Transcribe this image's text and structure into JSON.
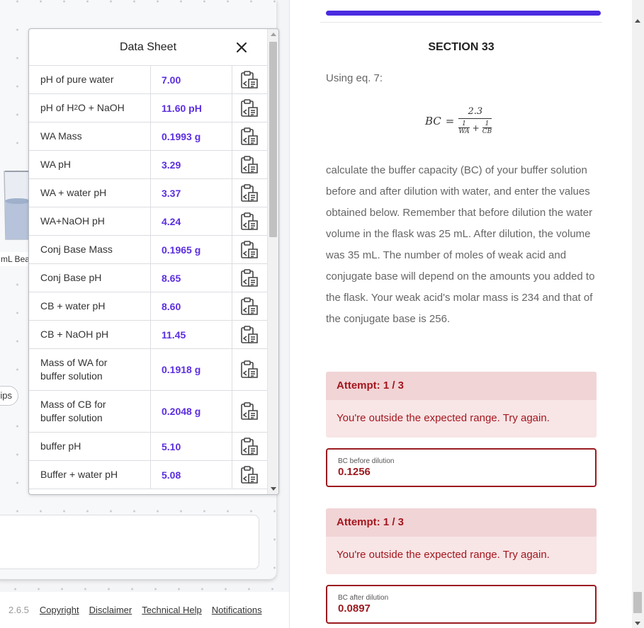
{
  "lab": {
    "beaker_label": "mL Bea",
    "tips_label": "ips",
    "version": "2.6.5",
    "footer_links": [
      "Copyright",
      "Disclaimer",
      "Technical Help",
      "Notifications"
    ]
  },
  "data_sheet": {
    "title": "Data Sheet",
    "rows": [
      {
        "label": "pH of pure water",
        "value": "7.00"
      },
      {
        "label_parts": [
          "pH of H",
          "2",
          "O + NaOH"
        ],
        "value": "11.60 pH"
      },
      {
        "label": "WA Mass",
        "value": "0.1993 g"
      },
      {
        "label": "WA pH",
        "value": "3.29"
      },
      {
        "label": "WA + water pH",
        "value": "3.37"
      },
      {
        "label": "WA+NaOH pH",
        "value": "4.24"
      },
      {
        "label": "Conj Base Mass",
        "value": "0.1965 g"
      },
      {
        "label": "Conj Base pH",
        "value": "8.65"
      },
      {
        "label": "CB + water pH",
        "value": "8.60"
      },
      {
        "label": "CB + NaOH pH",
        "value": "11.45"
      },
      {
        "label": "Mass of WA for buffer solution",
        "value": "0.1918 g"
      },
      {
        "label": "Mass of CB for buffer solution",
        "value": "0.2048 g"
      },
      {
        "label": "buffer pH",
        "value": "5.10"
      },
      {
        "label": "Buffer + water pH",
        "value": "5.08"
      }
    ]
  },
  "main": {
    "progress": 1.0,
    "section_title": "SECTION 33",
    "eq_label": "Using eq. 7:",
    "formula": {
      "lhs": "BC",
      "eq": "=",
      "numerator": "2.3",
      "term1_num": "1",
      "term1_den": "WA",
      "plus": "+",
      "term2_num": "1",
      "term2_den": "CB"
    },
    "instructions": "calculate the buffer capacity (BC) of your buffer solution before and after dilution with water, and enter the values obtained below. Remember that before dilution the water volume in the flask was 25 mL. After dilution, the volume was 35 mL. The number of moles of weak acid and conjugate base will depend on the amounts you added to the flask. Your weak acid's molar mass is 234 and that of the conjugate base is 256.",
    "attempts": [
      {
        "header": "Attempt: 1 / 3",
        "message": "You're outside the expected range. Try again.",
        "field_label": "BC before dilution",
        "field_value": "0.1256"
      },
      {
        "header": "Attempt: 1 / 3",
        "message": "You're outside the expected range. Try again.",
        "field_label": "BC after dilution",
        "field_value": "0.0897"
      }
    ]
  },
  "colors": {
    "accent": "#4a2be0",
    "value_purple": "#5b2ee0",
    "error_red": "#a3171e",
    "error_bg": "#f8e5e6"
  },
  "icons": {
    "close": "close-icon",
    "copy": "clipboard-paste-icon"
  }
}
